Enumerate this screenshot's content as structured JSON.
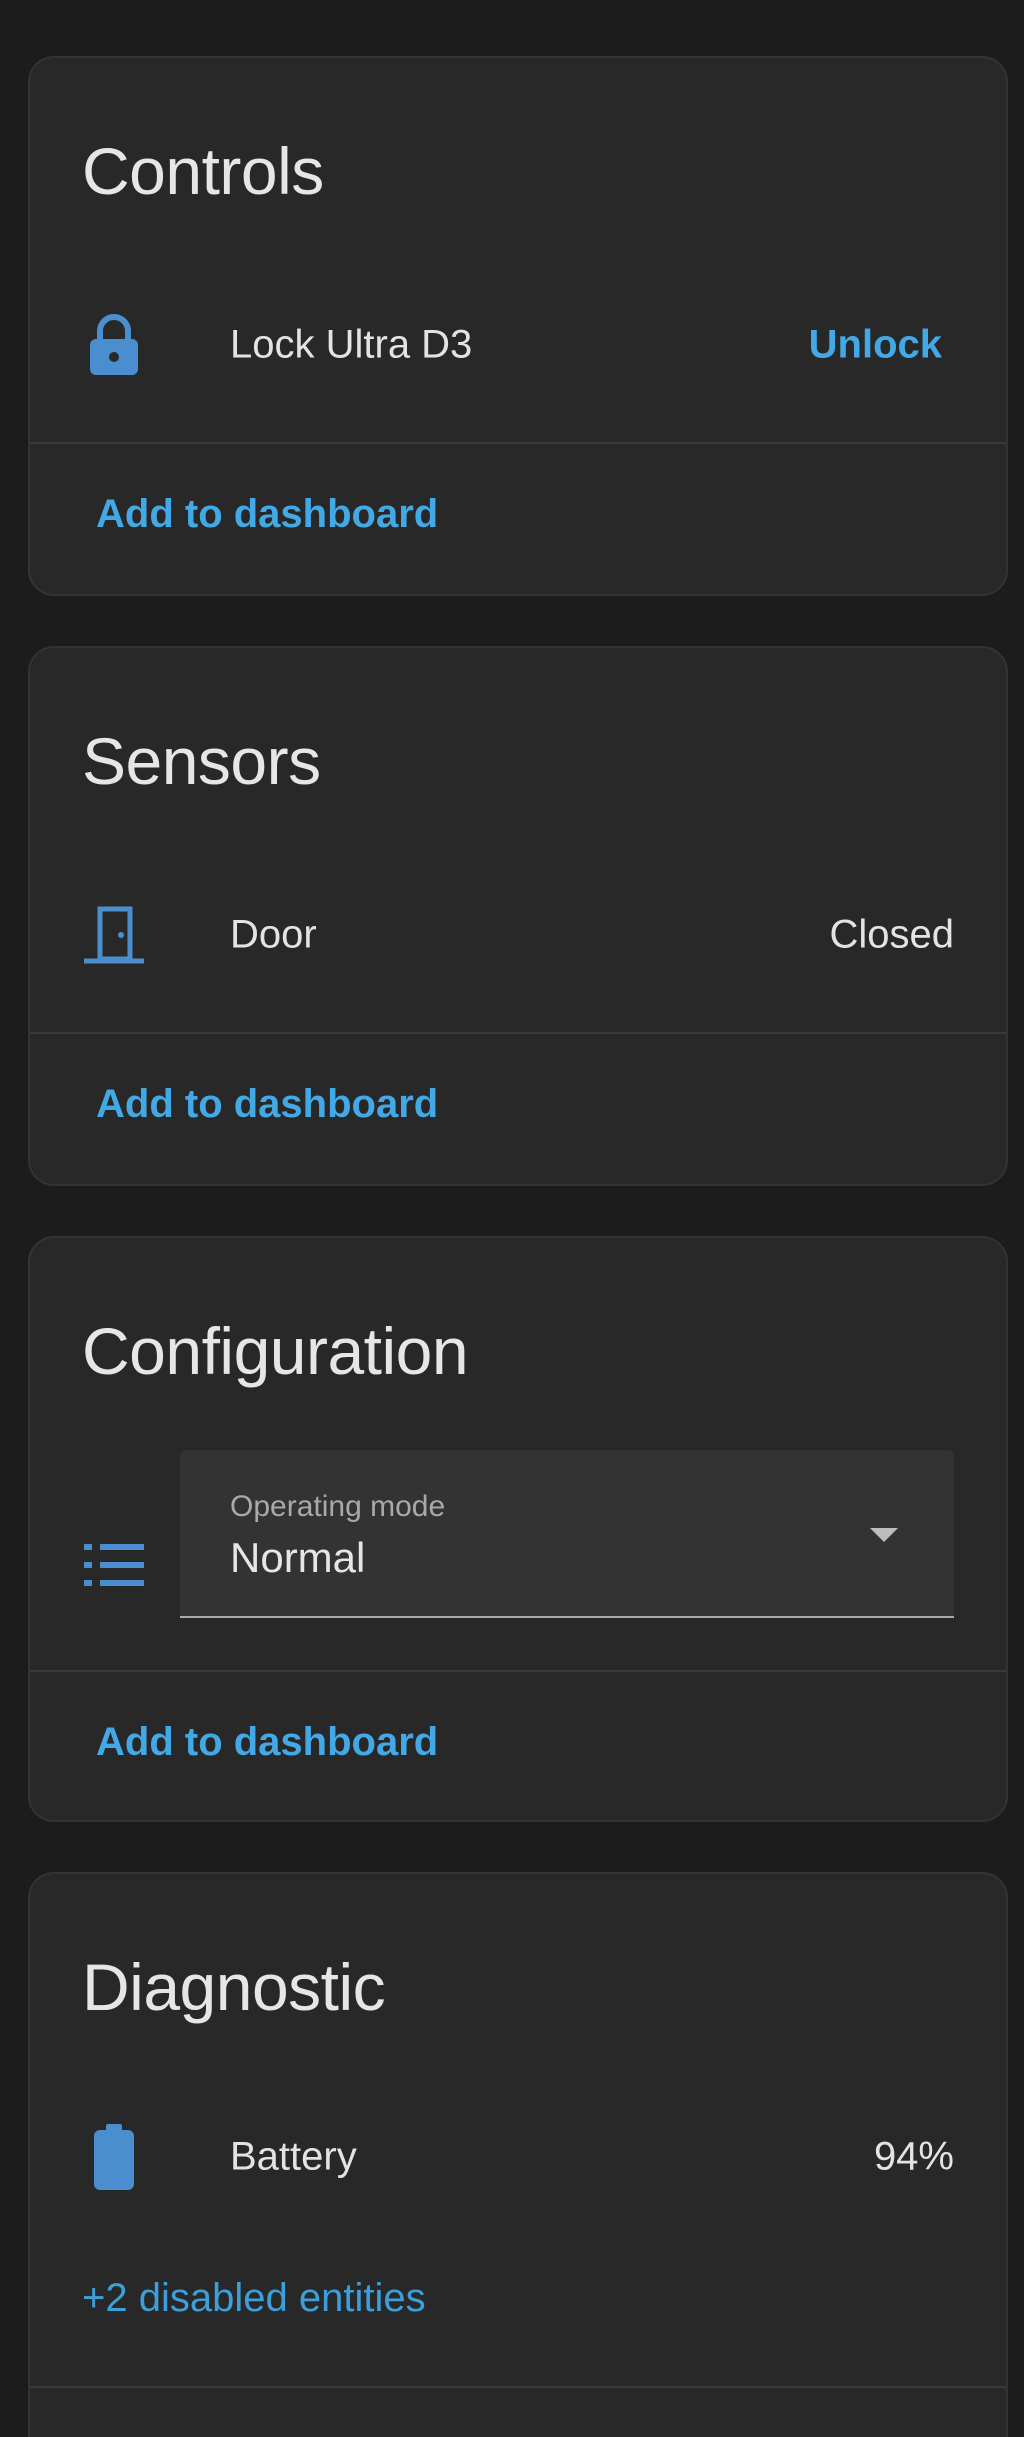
{
  "colors": {
    "background": "#1c1c1c",
    "card": "#282828",
    "accent": "#42a9e6",
    "icon": "#4a8ed0",
    "text": "#e3e3e3",
    "muted": "#a9a9a9"
  },
  "controls": {
    "title": "Controls",
    "entity": {
      "icon": "lock-icon",
      "name": "Lock Ultra D3",
      "action": "Unlock"
    },
    "footer": "Add to dashboard"
  },
  "sensors": {
    "title": "Sensors",
    "entity": {
      "icon": "door-icon",
      "name": "Door",
      "state": "Closed"
    },
    "footer": "Add to dashboard"
  },
  "configuration": {
    "title": "Configuration",
    "select": {
      "icon": "list-icon",
      "label": "Operating mode",
      "value": "Normal"
    },
    "footer": "Add to dashboard"
  },
  "diagnostic": {
    "title": "Diagnostic",
    "entity": {
      "icon": "battery-icon",
      "name": "Battery",
      "state": "94%"
    },
    "disabled_link": "+2 disabled entities"
  }
}
